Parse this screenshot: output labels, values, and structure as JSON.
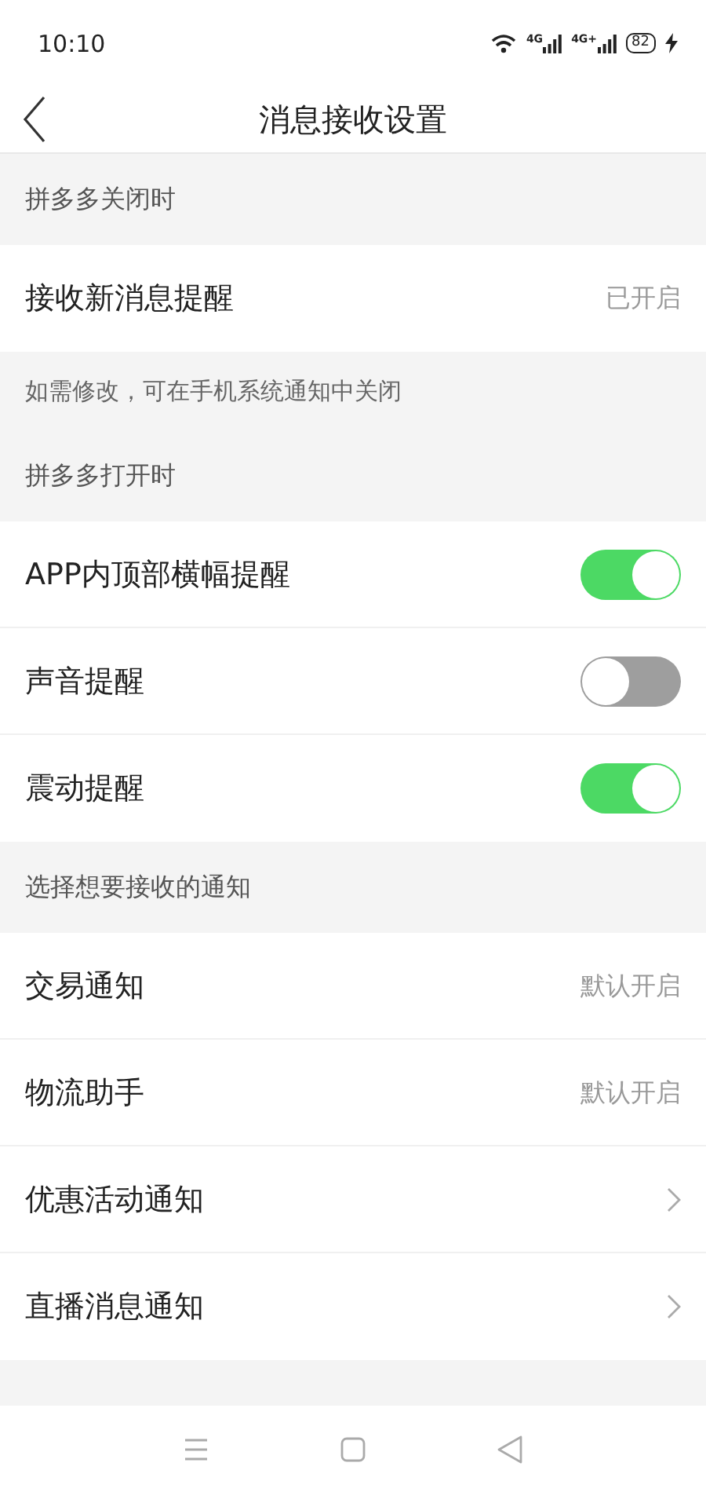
{
  "status_bar": {
    "time": "10:10",
    "network_labels": [
      "4G",
      "4G+"
    ],
    "battery": "82"
  },
  "header": {
    "title": "消息接收设置"
  },
  "sections": [
    {
      "title": "拼多多关闭时",
      "rows": [
        {
          "kind": "value",
          "label": "接收新消息提醒",
          "value": "已开启"
        }
      ],
      "note": "如需修改，可在手机系统通知中关闭"
    },
    {
      "title": "拼多多打开时",
      "rows": [
        {
          "kind": "toggle",
          "label": "APP内顶部横幅提醒",
          "on": true
        },
        {
          "kind": "toggle",
          "label": "声音提醒",
          "on": false
        },
        {
          "kind": "toggle",
          "label": "震动提醒",
          "on": true
        }
      ]
    },
    {
      "title": "选择想要接收的通知",
      "rows": [
        {
          "kind": "value",
          "label": "交易通知",
          "value": "默认开启"
        },
        {
          "kind": "value",
          "label": "物流助手",
          "value": "默认开启"
        },
        {
          "kind": "link",
          "label": "优惠活动通知"
        },
        {
          "kind": "link",
          "label": "直播消息通知"
        }
      ]
    }
  ]
}
